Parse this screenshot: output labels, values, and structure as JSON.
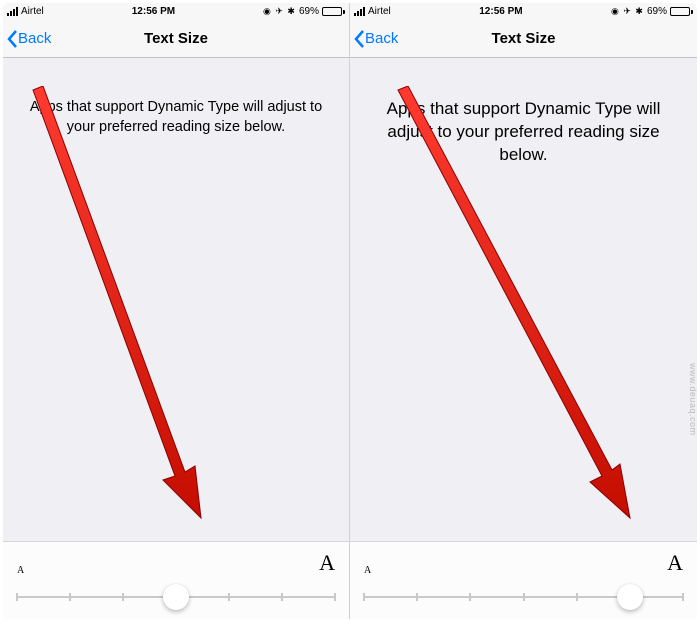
{
  "status": {
    "carrier": "Airtel",
    "time": "12:56 PM",
    "battery_pct": "69%",
    "icons": "⦿ ⇧ ✳"
  },
  "nav": {
    "back_label": "Back",
    "title": "Text Size"
  },
  "body": {
    "description": "Apps that support Dynamic Type will adjust to your preferred reading size below."
  },
  "slider": {
    "label_small": "A",
    "label_large": "A",
    "steps": 7,
    "left_value_index": 3,
    "right_value_index": 5
  },
  "watermark": "www.deuaq.com"
}
